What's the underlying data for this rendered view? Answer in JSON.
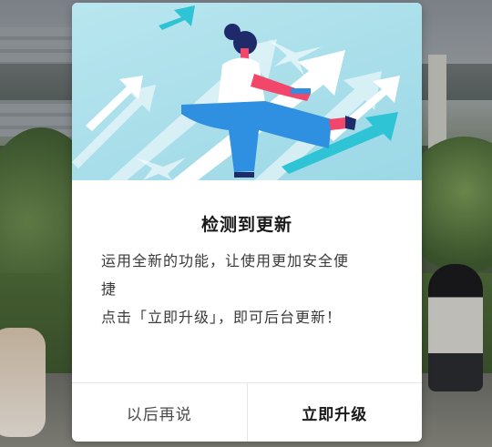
{
  "dialog": {
    "title": "检测到更新",
    "description_line1": "运用全新的功能，让使用更加安全便",
    "description_line2": "捷",
    "description_line3": "点击「立即升级」，即可后台更新！",
    "later_button": "以后再说",
    "upgrade_button": "立即升级"
  },
  "colors": {
    "hero_background": "#9bd8e6",
    "arrow_white": "#ffffff",
    "arrow_teal": "#2fc3d6",
    "figure_pants": "#2f8fe0",
    "figure_skin": "#f2476a",
    "figure_hair": "#1f2a6b"
  }
}
